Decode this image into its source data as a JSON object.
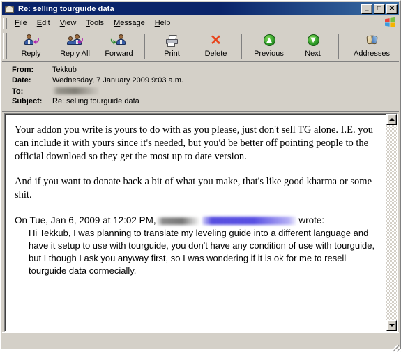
{
  "window": {
    "title": "Re: selling tourguide data",
    "icon": "envelope-icon",
    "buttons": {
      "minimize": "_",
      "maximize": "□",
      "close": "✕"
    }
  },
  "menubar": {
    "items": [
      {
        "label": "File",
        "accel": "F"
      },
      {
        "label": "Edit",
        "accel": "E"
      },
      {
        "label": "View",
        "accel": "V"
      },
      {
        "label": "Tools",
        "accel": "T"
      },
      {
        "label": "Message",
        "accel": "M"
      },
      {
        "label": "Help",
        "accel": "H"
      }
    ],
    "logo": "windows-logo-icon"
  },
  "toolbar": {
    "buttons": [
      {
        "label": "Reply",
        "icon": "reply-icon"
      },
      {
        "label": "Reply All",
        "icon": "reply-all-icon"
      },
      {
        "label": "Forward",
        "icon": "forward-icon"
      },
      {
        "label": "Print",
        "icon": "printer-icon"
      },
      {
        "label": "Delete",
        "icon": "delete-x-icon"
      },
      {
        "label": "Previous",
        "icon": "previous-up-arrow-icon"
      },
      {
        "label": "Next",
        "icon": "next-down-arrow-icon"
      },
      {
        "label": "Addresses",
        "icon": "address-book-icon"
      }
    ]
  },
  "headers": {
    "from_label": "From:",
    "from_value": "Tekkub",
    "date_label": "Date:",
    "date_value": "Wednesday, 7 January 2009 9:03 a.m.",
    "to_label": "To:",
    "to_value": "",
    "to_redacted": true,
    "subject_label": "Subject:",
    "subject_value": "Re: selling tourguide data"
  },
  "body": {
    "paragraph1": "Your addon you write is yours to do with as you please, just don't sell TG alone.  I.E. you can include it with yours since it's needed, but you'd be better off pointing people to the official download so they get the most up to date version.",
    "paragraph2": "And if you want to donate back a bit of what you make, that's like good kharma or some shit.",
    "quote_intro_prefix": "On Tue, Jan 6, 2009 at 12:02 PM,",
    "quote_intro_suffix": "wrote:",
    "quote_sender_redacted": true,
    "quote_text": "Hi Tekkub, I was planning to translate my leveling guide into a different language and have it setup to use with tourguide, you don't have any condition of use with tourguide, but I though I ask you anyway first, so I was wondering if it is ok for me to resell tourguide data cormecially."
  },
  "scrollbar": {
    "up_arrow": "scroll-up-icon",
    "down_arrow": "scroll-down-icon"
  },
  "statusbar": {
    "text": ""
  },
  "colors": {
    "titlebar_start": "#0a246a",
    "titlebar_end": "#3a6ea5",
    "chrome": "#d4d0c8",
    "body_bg": "#ffffff",
    "delete_icon": "#e8441c",
    "nav_icon_green": "#2e9b28"
  }
}
